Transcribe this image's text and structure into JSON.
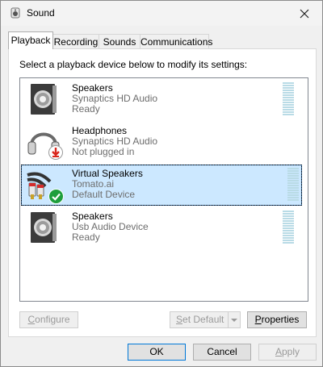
{
  "window": {
    "title": "Sound",
    "close_label": "✕"
  },
  "tabs": [
    {
      "label": "Playback",
      "active": true
    },
    {
      "label": "Recording",
      "active": false
    },
    {
      "label": "Sounds",
      "active": false
    },
    {
      "label": "Communications",
      "active": false
    }
  ],
  "instruction": "Select a playback device below to modify its settings:",
  "devices": [
    {
      "name": "Speakers",
      "driver": "Synaptics HD Audio",
      "status": "Ready",
      "icon": "speaker-icon",
      "selected": false
    },
    {
      "name": "Headphones",
      "driver": "Synaptics HD Audio",
      "status": "Not plugged in",
      "icon": "headphones-icon",
      "badge": "unplugged-arrow-icon",
      "selected": false
    },
    {
      "name": "Virtual Speakers",
      "driver": "Tomato.ai",
      "status": "Default Device",
      "icon": "audio-cable-icon",
      "badge": "default-checkmark-icon",
      "selected": true
    },
    {
      "name": "Speakers",
      "driver": "Usb Audio Device",
      "status": "Ready",
      "icon": "speaker-icon",
      "selected": false
    }
  ],
  "buttons": {
    "configure": {
      "pre": "",
      "accel": "C",
      "post": "onfigure"
    },
    "set_default": {
      "pre": "",
      "accel": "S",
      "post": "et Default"
    },
    "properties": {
      "pre": "",
      "accel": "P",
      "post": "roperties"
    },
    "ok": "OK",
    "cancel": "Cancel",
    "apply": {
      "pre": "",
      "accel": "A",
      "post": "pply"
    }
  },
  "colors": {
    "selection": "#cce8ff",
    "accent": "#0078d7",
    "check": "#1e9e3c",
    "unplug": "#d9261c"
  }
}
